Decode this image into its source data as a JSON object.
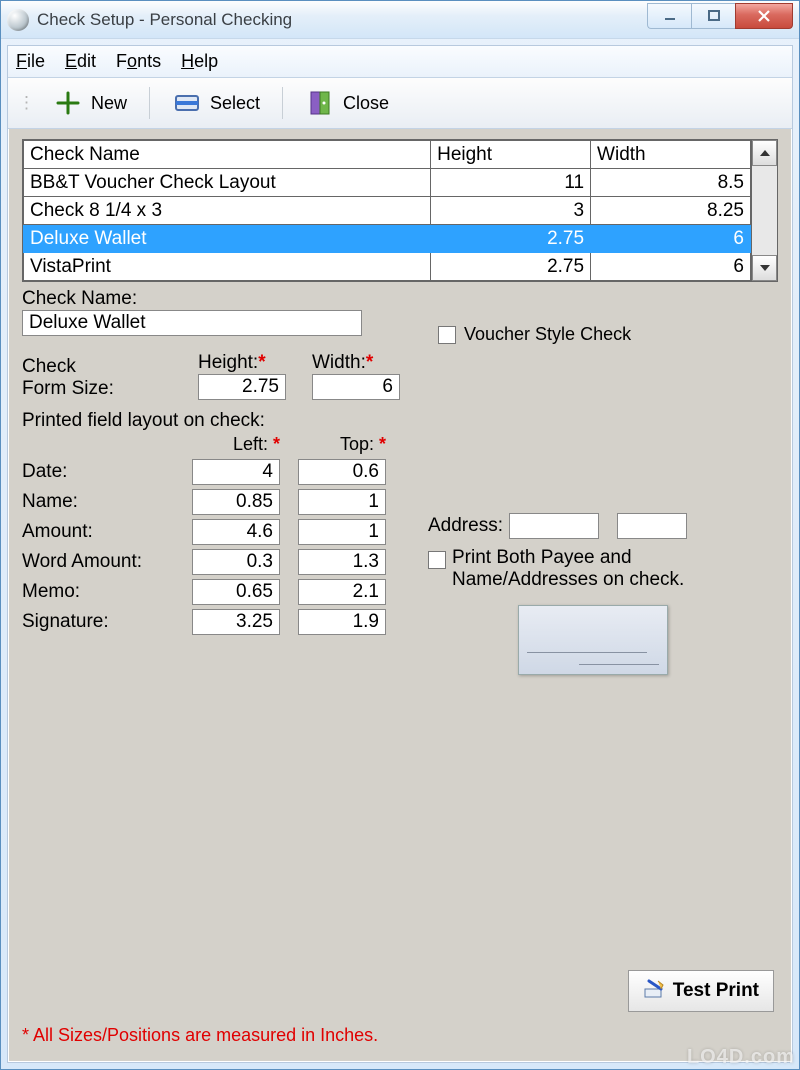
{
  "window": {
    "title": "Check Setup - Personal Checking"
  },
  "menus": {
    "file": "File",
    "edit": "Edit",
    "fonts": "Fonts",
    "help": "Help"
  },
  "toolbar": {
    "new": "New",
    "select": "Select",
    "close": "Close"
  },
  "table": {
    "headers": {
      "name": "Check Name",
      "height": "Height",
      "width": "Width"
    },
    "rows": [
      {
        "name": "BB&T Voucher Check Layout",
        "height": "11",
        "width": "8.5"
      },
      {
        "name": "Check 8 1/4 x 3",
        "height": "3",
        "width": "8.25"
      },
      {
        "name": "Deluxe Wallet",
        "height": "2.75",
        "width": "6"
      },
      {
        "name": "VistaPrint",
        "height": "2.75",
        "width": "6"
      }
    ],
    "selected_index": 2
  },
  "form": {
    "check_name_label": "Check Name:",
    "check_name_value": "Deluxe Wallet",
    "voucher_label": "Voucher Style Check",
    "form_size_label_1": "Check",
    "form_size_label_2": "Form Size:",
    "height_label": "Height:",
    "width_label": "Width:",
    "height_value": "2.75",
    "width_value": "6",
    "layout_heading": "Printed field layout on check:",
    "left_label": "Left:",
    "top_label": "Top:",
    "fields": {
      "date": {
        "label": "Date:",
        "left": "4",
        "top": "0.6"
      },
      "name": {
        "label": "Name:",
        "left": "0.85",
        "top": "1"
      },
      "amount": {
        "label": "Amount:",
        "left": "4.6",
        "top": "1"
      },
      "word_amount": {
        "label": "Word Amount:",
        "left": "0.3",
        "top": "1.3"
      },
      "memo": {
        "label": "Memo:",
        "left": "0.65",
        "top": "2.1"
      },
      "signature": {
        "label": "Signature:",
        "left": "3.25",
        "top": "1.9"
      }
    },
    "address_label": "Address:",
    "print_both_label_1": "Print Both Payee and",
    "print_both_label_2": "Name/Addresses on check."
  },
  "buttons": {
    "test_print": "Test Print"
  },
  "footnote": "* All Sizes/Positions are measured in Inches.",
  "watermark": "LO4D.com"
}
